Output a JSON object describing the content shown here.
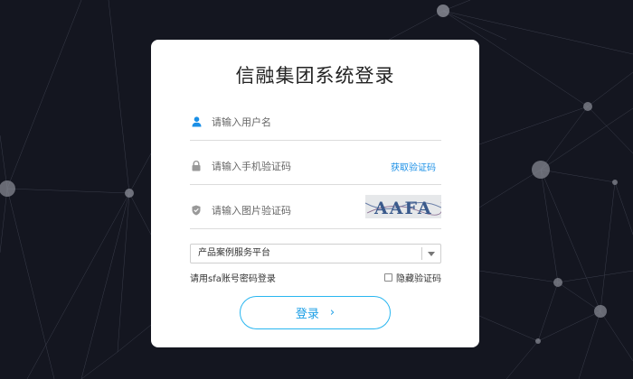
{
  "login": {
    "title": "信融集团系统登录",
    "username_placeholder": "请输入用户名",
    "sms_code_placeholder": "请输入手机验证码",
    "get_code_label": "获取验证码",
    "image_code_placeholder": "请输入图片验证码",
    "captcha_text": "AAFA",
    "platform_selected": "产品案例服务平台",
    "alt_login_label": "请用sfa账号密码登录",
    "hide_captcha_label": "隐藏验证码",
    "hide_captcha_checked": false,
    "submit_label": "登录",
    "submit_arrow": "›"
  },
  "colors": {
    "background": "#141620",
    "accent": "#1a9ee6",
    "button_border": "#29b6f0",
    "user_icon": "#1a8fe6"
  },
  "icons": [
    "user-icon",
    "lock-icon",
    "shield-icon",
    "chevron-down-icon",
    "chevron-right-icon"
  ]
}
